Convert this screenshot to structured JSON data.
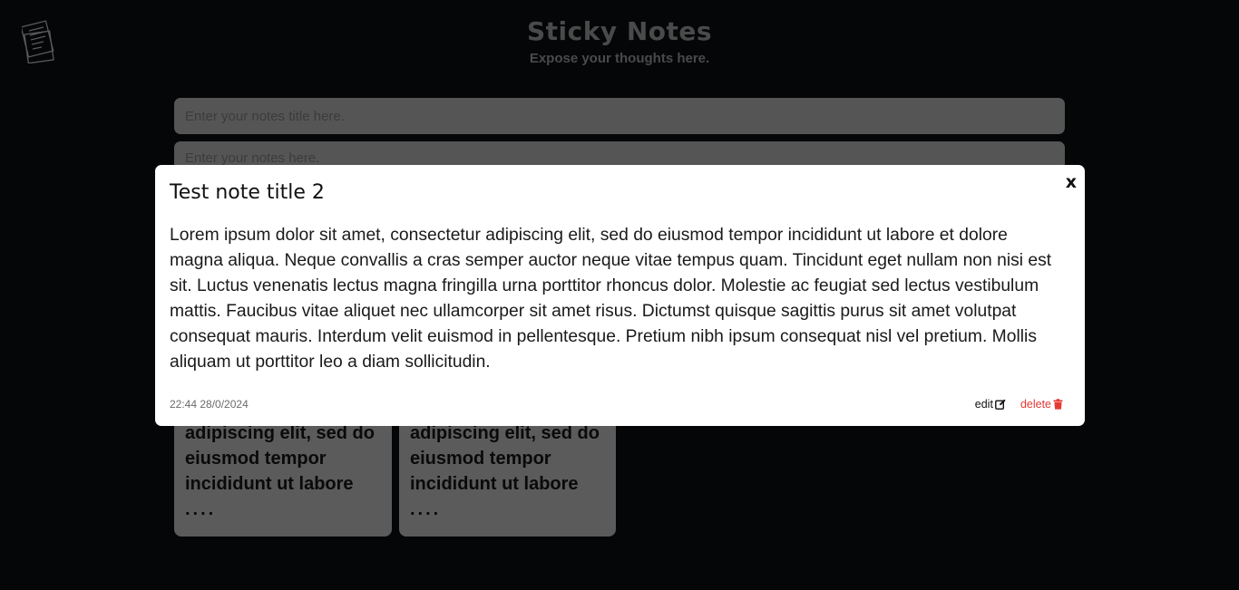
{
  "app": {
    "title": "Sticky Notes",
    "subtitle": "Expose your thoughts here.",
    "logo_icon": "notes-logo-icon"
  },
  "form": {
    "title_placeholder": "Enter your notes title here.",
    "body_placeholder": "Enter your notes here."
  },
  "notes": [
    {
      "text_lines": [
        "adipiscing elit, sed do",
        "eiusmod tempor",
        "incididunt ut labore"
      ],
      "ellipsis": "...."
    },
    {
      "text_lines": [
        "adipiscing elit, sed do",
        "eiusmod tempor",
        "incididunt ut labore"
      ],
      "ellipsis": "...."
    }
  ],
  "modal": {
    "close_label": "x",
    "title": "Test note title 2",
    "body": "Lorem ipsum dolor sit amet, consectetur adipiscing elit, sed do eiusmod tempor incididunt ut labore et dolore magna aliqua. Neque convallis a cras semper auctor neque vitae tempus quam. Tincidunt eget nullam non nisi est sit. Luctus venenatis lectus magna fringilla urna porttitor rhoncus dolor. Molestie ac feugiat sed lectus vestibulum mattis. Faucibus vitae aliquet nec ullamcorper sit amet risus. Dictumst quisque sagittis purus sit amet volutpat consequat mauris. Interdum velit euismod in pellentesque. Pretium nibh ipsum consequat nisl vel pretium. Mollis aliquam ut porttitor leo a diam sollicitudin.",
    "timestamp": "22:44 28/0/2024",
    "edit_label": "edit",
    "delete_label": "delete",
    "edit_icon": "edit-icon",
    "delete_icon": "trash-icon"
  },
  "colors": {
    "background": "#050608",
    "modal_background": "#ffffff",
    "delete_accent": "#e53935",
    "card_background": "#5b5b5b"
  }
}
